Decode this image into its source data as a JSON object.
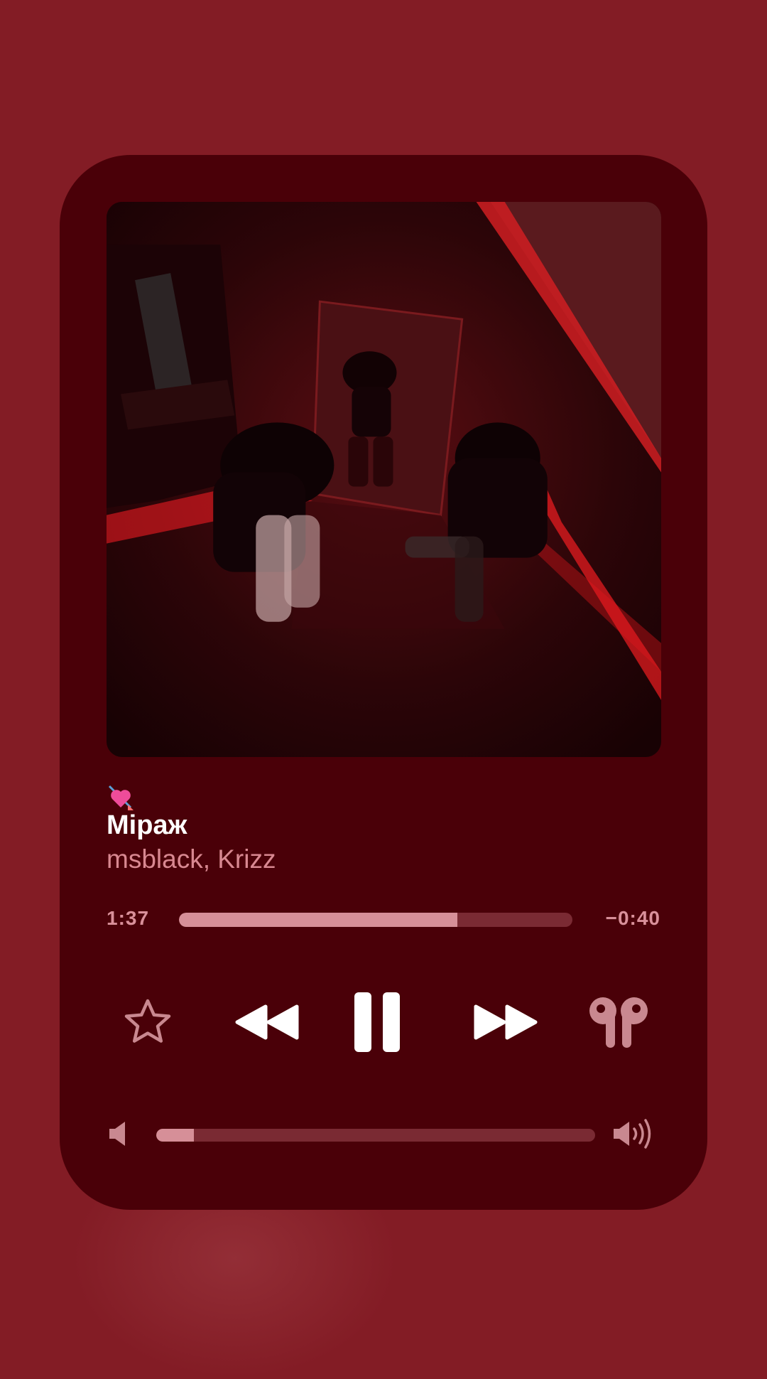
{
  "colors": {
    "background": "#831c25",
    "card": "#4a0008",
    "accent": "#d68f98",
    "artist_text": "#d88891",
    "track_background": "#7a2a33"
  },
  "now_playing": {
    "emoji_icon": "heart-with-arrow-icon",
    "title": "Міраж",
    "artist": "msblack, Krizz",
    "album_art": "album-cover-image"
  },
  "progress": {
    "elapsed": "1:37",
    "remaining": "−0:40",
    "fraction": 0.708
  },
  "controls": {
    "favorite_icon": "star-icon",
    "rewind_icon": "rewind-icon",
    "play_state_icon": "pause-icon",
    "forward_icon": "fast-forward-icon",
    "output_device_icon": "airpods-icon"
  },
  "volume": {
    "low_icon": "speaker-low-icon",
    "high_icon": "speaker-high-icon",
    "fraction": 0.085
  }
}
